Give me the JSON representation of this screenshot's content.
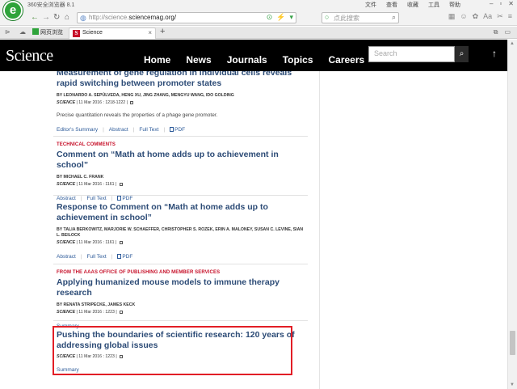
{
  "browser": {
    "app_title": "360安全浏览器 8.1",
    "menus": [
      "文件",
      "查看",
      "收藏",
      "工具",
      "帮助"
    ],
    "url_prefix": "http://science.",
    "url_domain": "sciencemag.org/",
    "search_placeholder": "点此搜索",
    "bookmark_label": "网页浏览",
    "tab_label": "Science",
    "tab_favicon": "S"
  },
  "site": {
    "logo": "Science",
    "nav": [
      "Home",
      "News",
      "Journals",
      "Topics",
      "Careers"
    ],
    "search_placeholder": "Search",
    "scroll_top": "↑"
  },
  "articles": [
    {
      "kicker": "",
      "title": "Measurement of gene regulation in individual cells reveals rapid switching between promoter states",
      "authors": "By Leonardo A. Sepúlveda, Heng Xu, Jing Zhang, Mengyu Wang, Ido Golding",
      "journal": "SCIENCE",
      "date": "11 Mar 2016 : 1218-1222",
      "summary": "Precise quantitation reveals the properties of a phage gene promoter.",
      "links": [
        "Editor's Summary",
        "Abstract",
        "Full Text",
        "PDF"
      ]
    },
    {
      "kicker": "Technical Comments",
      "title": "Comment on “Math at home adds up to achievement in school”",
      "authors": "By Michael C. Frank",
      "journal": "SCIENCE",
      "date": "11 Mar 2016 : 1161",
      "summary": "",
      "links": [
        "Abstract",
        "Full Text",
        "PDF"
      ]
    },
    {
      "kicker": "",
      "title": "Response to Comment on “Math at home adds up to achievement in school”",
      "authors": "By Talia Berkowitz, Marjorie W. Schaeffer, Christopher S. Rozek, Erin A. Maloney, Susan C. Levine, Sian L. Beilock",
      "journal": "SCIENCE",
      "date": "11 Mar 2016 : 1161",
      "summary": "",
      "links": [
        "Abstract",
        "Full Text",
        "PDF"
      ]
    },
    {
      "kicker": "From the AAAS Office of Publishing and Member Services",
      "title": "Applying humanized mouse models to immune therapy research",
      "authors": "By Renata Stripecke, James Keck",
      "journal": "SCIENCE",
      "date": "11 Mar 2016 : 1223",
      "summary": "",
      "links": [
        "Summary"
      ]
    },
    {
      "kicker": "",
      "title": "Pushing the boundaries of scientific research: 120 years of addressing global issues",
      "authors": "",
      "journal": "SCIENCE",
      "date": "11 Mar 2016 : 1223",
      "summary": "",
      "links": [
        "Summary"
      ]
    }
  ],
  "colors": {
    "header_bg": "#000000",
    "title_blue": "#2c4b76",
    "kicker_red": "#c7112a",
    "highlight_red": "#e21e26"
  }
}
